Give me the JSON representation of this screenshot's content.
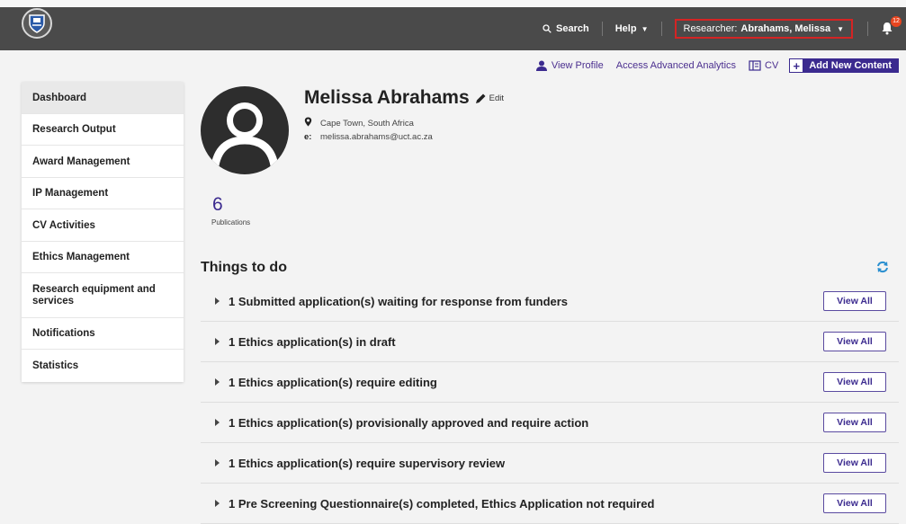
{
  "header": {
    "search_label": "Search",
    "help_label": "Help",
    "researcher_prefix": "Researcher:",
    "researcher_name": "Abrahams, Melissa",
    "notification_count": "12"
  },
  "actions": {
    "view_profile": "View Profile",
    "analytics": "Access Advanced Analytics",
    "cv": "CV",
    "add_content": "Add New Content"
  },
  "sidebar": {
    "items": [
      {
        "label": "Dashboard"
      },
      {
        "label": "Research Output"
      },
      {
        "label": "Award Management"
      },
      {
        "label": "IP Management"
      },
      {
        "label": "CV Activities"
      },
      {
        "label": "Ethics Management"
      },
      {
        "label": "Research equipment and services"
      },
      {
        "label": "Notifications"
      },
      {
        "label": "Statistics"
      }
    ]
  },
  "profile": {
    "name": "Melissa Abrahams",
    "edit_label": "Edit",
    "location": "Cape Town, South Africa",
    "email_prefix": "e:",
    "email": "melissa.abrahams@uct.ac.za",
    "publication_count": "6",
    "publication_label": "Publications"
  },
  "todo": {
    "title": "Things to do",
    "view_all_label": "View All",
    "items": [
      {
        "text": "1 Submitted application(s) waiting for response from funders"
      },
      {
        "text": "1 Ethics application(s) in draft"
      },
      {
        "text": "1 Ethics application(s) require editing"
      },
      {
        "text": "1 Ethics application(s) provisionally approved and require action"
      },
      {
        "text": "1 Ethics application(s) require supervisory review"
      },
      {
        "text": "1 Pre Screening Questionnaire(s) completed, Ethics Application not required"
      }
    ]
  },
  "colors": {
    "accent": "#3b2a8f",
    "topbar": "#4a4a4a",
    "researcher_outline": "#d42424"
  }
}
